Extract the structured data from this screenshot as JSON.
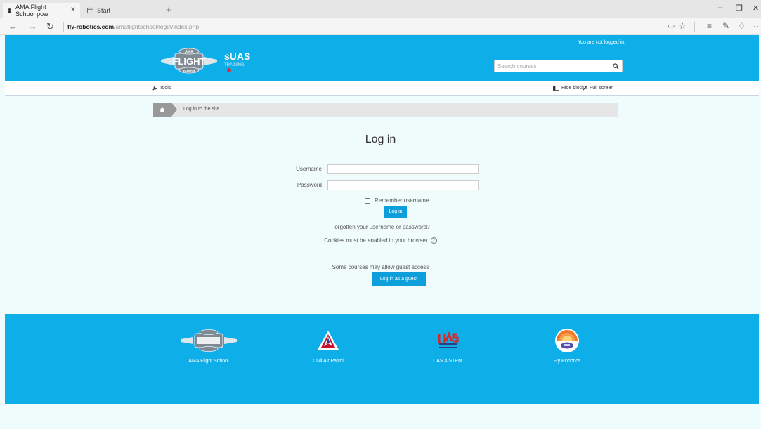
{
  "browser": {
    "tabs": [
      {
        "title": "AMA Flight School pow",
        "active": true
      },
      {
        "title": "Start",
        "active": false
      }
    ],
    "new_tab": "+",
    "url_host": "fly-robotics.com",
    "url_path": "/amaflightschool/login/index.php",
    "window_controls": {
      "minimize": "–",
      "restore": "❐",
      "close": "✕"
    }
  },
  "header": {
    "login_status": "You are not logged in.",
    "logo_text_main": "FLIGHT",
    "logo_text_top": "AMA",
    "logo_text_bottom": "SCHOOL",
    "logo_suas": "sUAS",
    "logo_training": "TRAINING",
    "search": {
      "placeholder": "Search courses"
    }
  },
  "toolbar": {
    "tools_label": "Tools",
    "hide_blocks_label": "Hide blocks",
    "full_screen_label": "Full screen"
  },
  "breadcrumb": {
    "current": "Log in to the site"
  },
  "login": {
    "title": "Log in",
    "username_label": "Username",
    "password_label": "Password",
    "remember_label": "Remember username",
    "login_button": "Log in",
    "forgotten_link": "Forgotten your username or password?",
    "cookies_text": "Cookies must be enabled in your browser",
    "guest_text": "Some courses may allow guest access",
    "guest_button": "Log in as a guest"
  },
  "footer": {
    "items": [
      {
        "label": "AMA Flight School",
        "icon": "ama-flight-school-logo"
      },
      {
        "label": "Civil Air Patrol",
        "icon": "civil-air-patrol-logo"
      },
      {
        "label": "UAS 4 STEM",
        "icon": "uas-4-stem-logo"
      },
      {
        "label": "Fly Robotics",
        "icon": "fly-robotics-logo"
      }
    ]
  },
  "colors": {
    "brand_blue": "#0eaee9",
    "button_blue": "#0d9fdb",
    "page_bg": "#f0fbfb"
  }
}
